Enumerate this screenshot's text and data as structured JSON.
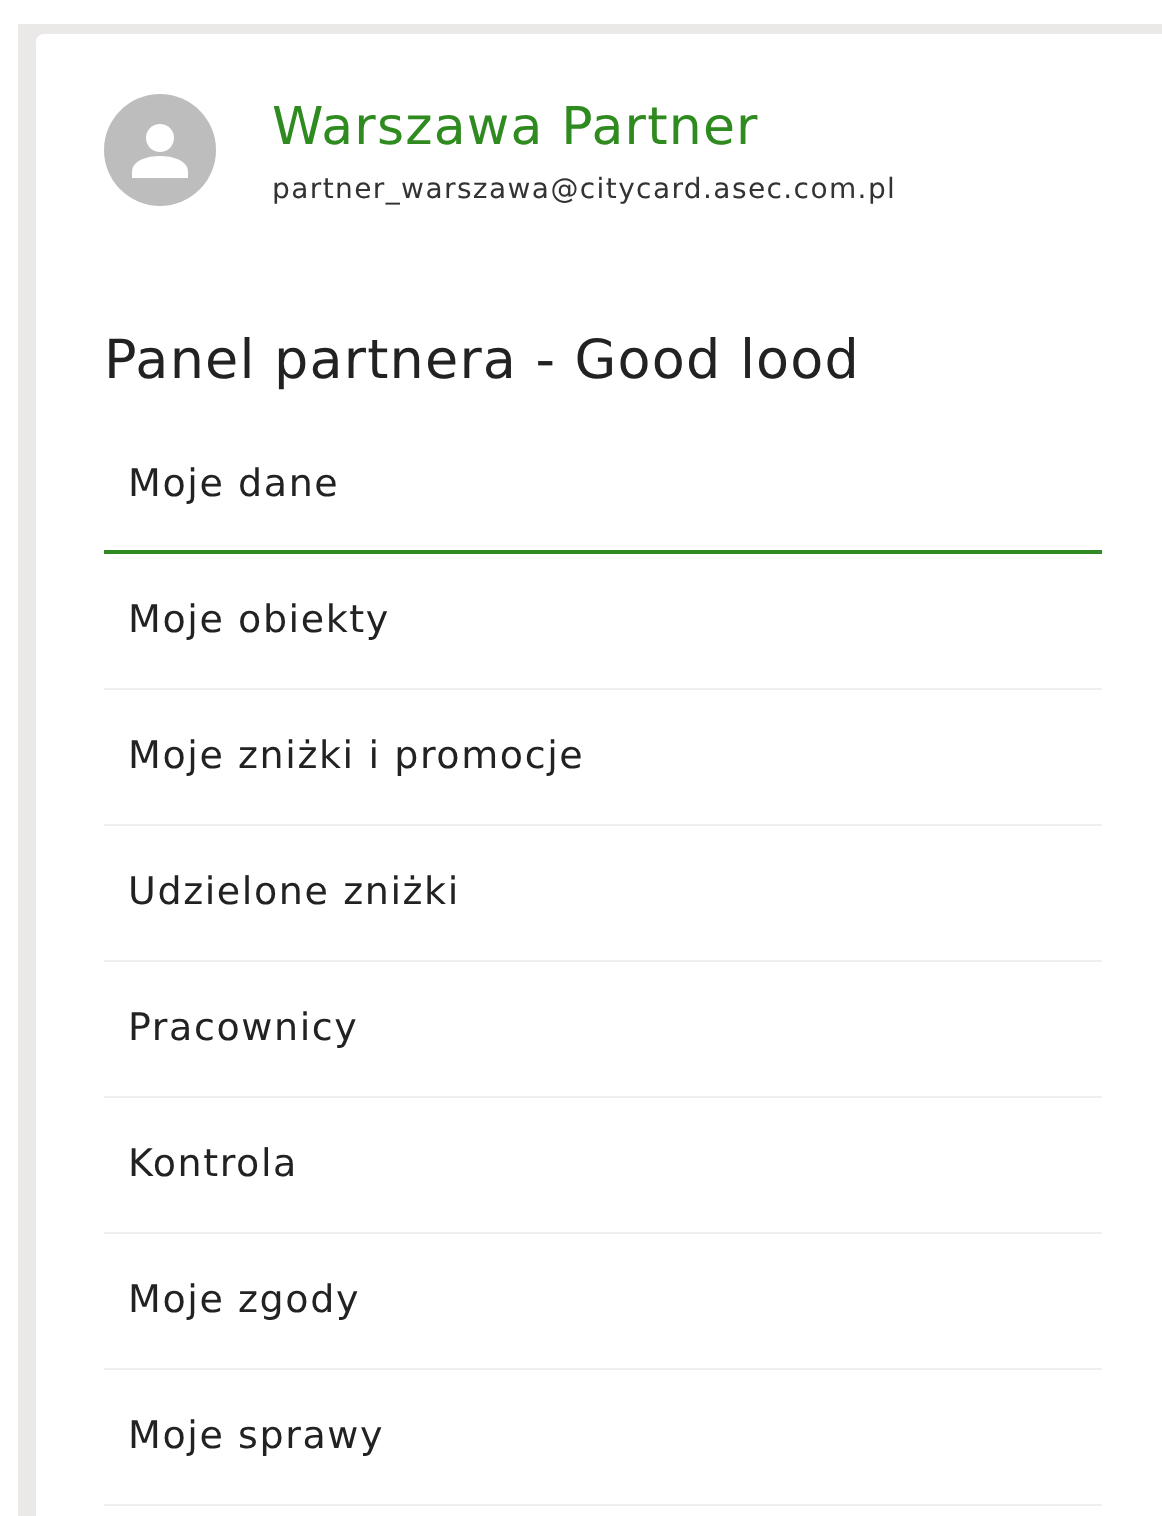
{
  "profile": {
    "name": "Warszawa Partner",
    "email": "partner_warszawa@citycard.asec.com.pl"
  },
  "panel_title": "Panel partnera - Good lood",
  "menu": [
    {
      "label": "Moje dane",
      "selected": true
    },
    {
      "label": "Moje obiekty",
      "selected": false
    },
    {
      "label": "Moje zniżki i promocje",
      "selected": false
    },
    {
      "label": "Udzielone zniżki",
      "selected": false
    },
    {
      "label": "Pracownicy",
      "selected": false
    },
    {
      "label": "Kontrola",
      "selected": false
    },
    {
      "label": "Moje zgody",
      "selected": false
    },
    {
      "label": "Moje sprawy",
      "selected": false
    }
  ]
}
